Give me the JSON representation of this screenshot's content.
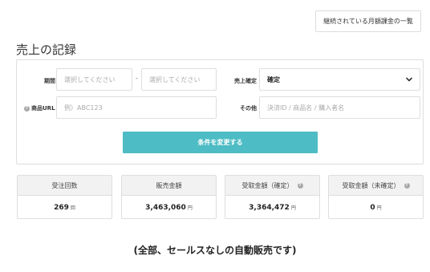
{
  "top_button_label": "継続されている月額課金の一覧",
  "page_title": "売上の記録",
  "form": {
    "period_label": "期間",
    "date_from_placeholder": "選択してください",
    "date_separator": "-",
    "date_to_placeholder": "選択してください",
    "sales_status_label": "売上確定",
    "sales_status_value": "確定",
    "product_url_label": "商品URL",
    "product_url_placeholder": "例）ABC123",
    "other_label": "その他",
    "other_placeholder": "決済ID / 商品名 / 購入者名",
    "submit_label": "条件を変更する"
  },
  "stats": [
    {
      "title": "受注回数",
      "value": "269",
      "unit": "回",
      "help": false
    },
    {
      "title": "販売金額",
      "value": "3,463,060",
      "unit": "円",
      "help": false
    },
    {
      "title": "受取金額（確定）",
      "value": "3,364,472",
      "unit": "円",
      "help": true
    },
    {
      "title": "受取金額（未確定）",
      "value": "0",
      "unit": "円",
      "help": true
    }
  ],
  "footer_note": "(全部、セールスなしの自動販売です)",
  "icons": {
    "help": "question-circle-icon",
    "chevron": "chevron-down-icon"
  },
  "colors": {
    "accent": "#4ebcc4",
    "border": "#dedede",
    "stat_header_bg": "#f2f2f2"
  }
}
